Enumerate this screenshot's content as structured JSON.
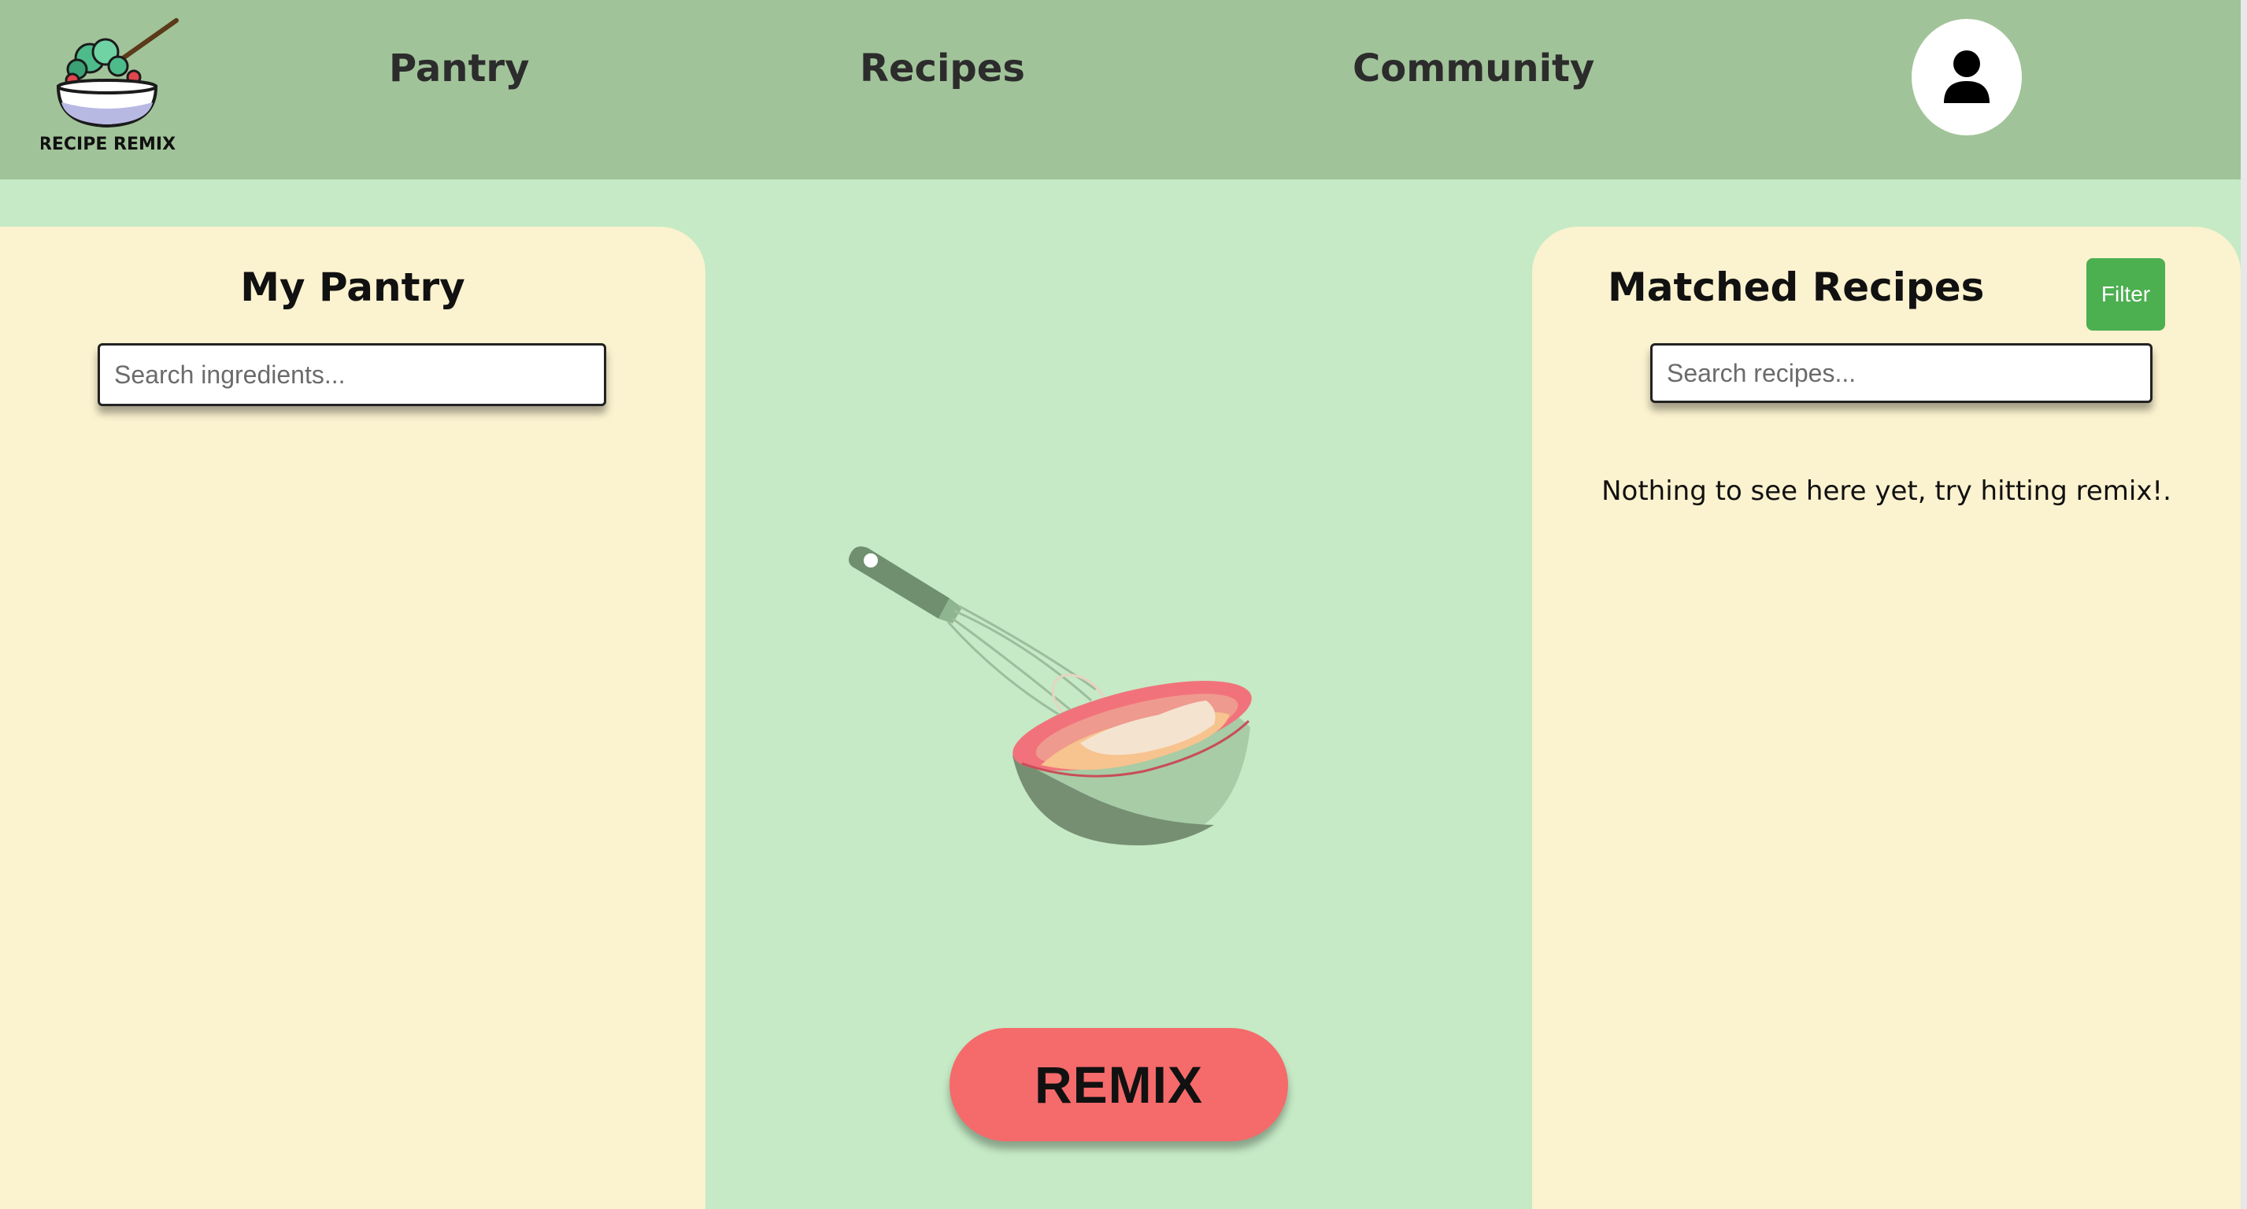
{
  "brand": {
    "logo_text": "RECIPE REMIX",
    "logo_icon": "salad-bowl-logo"
  },
  "nav": {
    "pantry": "Pantry",
    "recipes": "Recipes",
    "community": "Community",
    "profile_icon": "user-icon"
  },
  "pantry_panel": {
    "title": "My Pantry",
    "search_placeholder": "Search ingredients..."
  },
  "recipes_panel": {
    "title": "Matched Recipes",
    "filter_label": "Filter",
    "search_placeholder": "Search recipes...",
    "empty_message": "Nothing to see here yet, try hitting remix!."
  },
  "center": {
    "illustration_icon": "mixing-bowl-whisk-illustration",
    "remix_label": "REMIX"
  },
  "colors": {
    "header_bg": "#a1c399",
    "page_bg": "#c5eac5",
    "panel_bg": "#fbf2cf",
    "remix_button": "#f56a6a",
    "filter_button": "#4caf50"
  }
}
